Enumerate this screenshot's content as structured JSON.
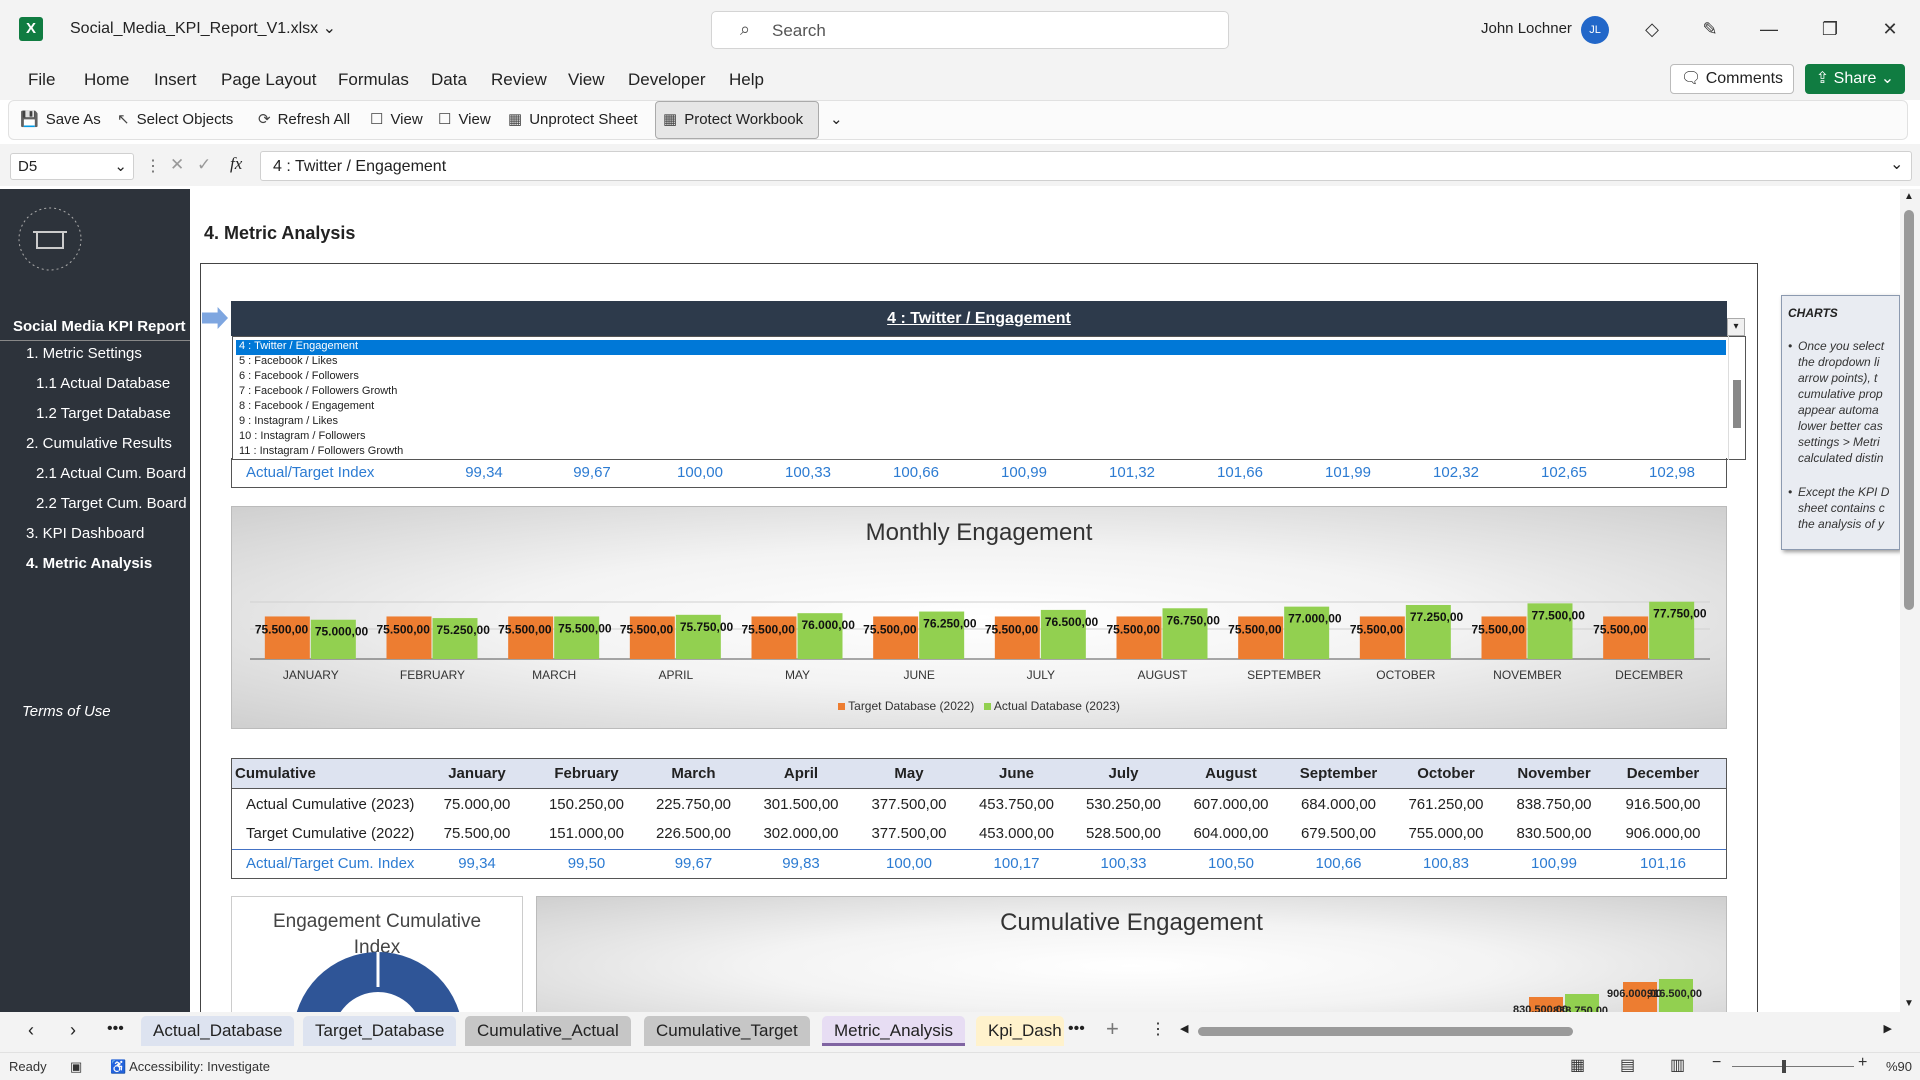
{
  "window": {
    "filename": "Social_Media_KPI_Report_V1.xlsx",
    "search_placeholder": "Search",
    "user": "John Lochner",
    "avatar": "JL"
  },
  "menu": [
    "File",
    "Home",
    "Insert",
    "Page Layout",
    "Formulas",
    "Data",
    "Review",
    "View",
    "Developer",
    "Help"
  ],
  "comments": "Comments",
  "share": "Share",
  "ribbon": {
    "save_as": "Save As",
    "select_objects": "Select Objects",
    "refresh_all": "Refresh All",
    "view1": "View",
    "view2": "View",
    "unprotect": "Unprotect Sheet",
    "protect": "Protect Workbook"
  },
  "formula": {
    "cell": "D5",
    "fx": "fx",
    "value": "4 : Twitter / Engagement"
  },
  "sidebar": {
    "title": "Social Media KPI Report",
    "items": [
      "1. Metric Settings",
      "1.1 Actual Database",
      "1.2 Target Database",
      "2. Cumulative Results",
      "2.1 Actual Cum. Board",
      "2.2 Target Cum. Board",
      "3. KPI Dashboard",
      "4. Metric Analysis"
    ],
    "terms": "Terms of Use"
  },
  "page_title": "4. Metric Analysis",
  "selector": {
    "value": "4 : Twitter / Engagement",
    "options": [
      "4 : Twitter / Engagement",
      "5 : Facebook / Likes",
      "6 : Facebook / Followers",
      "7 : Facebook / Followers Growth",
      "8 : Facebook / Engagement",
      "9 : Instagram / Likes",
      "10 : Instagram / Followers",
      "11 : Instagram / Followers Growth"
    ]
  },
  "index_row": {
    "label": "Actual/Target Index",
    "values": [
      "99,34",
      "99,67",
      "100,00",
      "100,33",
      "100,66",
      "100,99",
      "101,32",
      "101,66",
      "101,99",
      "102,32",
      "102,65",
      "102,98"
    ]
  },
  "chart_data": [
    {
      "type": "bar",
      "title": "Monthly Engagement",
      "categories": [
        "JANUARY",
        "FEBRUARY",
        "MARCH",
        "APRIL",
        "MAY",
        "JUNE",
        "JULY",
        "AUGUST",
        "SEPTEMBER",
        "OCTOBER",
        "NOVEMBER",
        "DECEMBER"
      ],
      "series": [
        {
          "name": "Target Database (2022)",
          "color": "#ed7d31",
          "values": [
            75500,
            75500,
            75500,
            75500,
            75500,
            75500,
            75500,
            75500,
            75500,
            75500,
            75500,
            75500
          ],
          "labels": [
            "75.500,00",
            "75.500,00",
            "75.500,00",
            "75.500,00",
            "75.500,00",
            "75.500,00",
            "75.500,00",
            "75.500,00",
            "75.500,00",
            "75.500,00",
            "75.500,00",
            "75.500,00"
          ]
        },
        {
          "name": "Actual Database (2023)",
          "color": "#92d050",
          "values": [
            75000,
            75250,
            75500,
            75750,
            76000,
            76250,
            76500,
            76750,
            77000,
            77250,
            77500,
            77750
          ],
          "labels": [
            "75.000,00",
            "75.250,00",
            "75.500,00",
            "75.750,00",
            "76.000,00",
            "76.250,00",
            "76.500,00",
            "76.750,00",
            "77.000,00",
            "77.250,00",
            "77.500,00",
            "77.750,00"
          ]
        }
      ],
      "legend": "bottom"
    },
    {
      "type": "bar",
      "title": "Cumulative Engagement",
      "visible_labels": [
        "830.500,00",
        "838.750,00",
        "906.000,00",
        "916.500,00"
      ]
    }
  ],
  "cumulative": {
    "header": [
      "Cumulative",
      "January",
      "February",
      "March",
      "April",
      "May",
      "June",
      "July",
      "August",
      "September",
      "October",
      "November",
      "December"
    ],
    "rows": [
      {
        "label": "Actual Cumulative (2023)",
        "values": [
          "75.000,00",
          "150.250,00",
          "225.750,00",
          "301.500,00",
          "377.500,00",
          "453.750,00",
          "530.250,00",
          "607.000,00",
          "684.000,00",
          "761.250,00",
          "838.750,00",
          "916.500,00"
        ]
      },
      {
        "label": "Target Cumulative (2022)",
        "values": [
          "75.500,00",
          "151.000,00",
          "226.500,00",
          "302.000,00",
          "377.500,00",
          "453.000,00",
          "528.500,00",
          "604.000,00",
          "679.500,00",
          "755.000,00",
          "830.500,00",
          "906.000,00"
        ]
      },
      {
        "label": "Actual/Target Cum. Index",
        "values": [
          "99,34",
          "99,50",
          "99,67",
          "99,83",
          "100,00",
          "100,17",
          "100,33",
          "100,50",
          "100,66",
          "100,83",
          "100,99",
          "101,16"
        ]
      }
    ]
  },
  "gauge_title": "Engagement Cumulative Index",
  "notes": {
    "title": "CHARTS",
    "b1": "Once you select the dropdown li arrow points), t cumulative prop appear automa lower better cas settings > Metri calculated distin",
    "b2": "Except the KPI D sheet contains c the analysis of y"
  },
  "tabs": [
    "Actual_Database",
    "Target_Database",
    "Cumulative_Actual",
    "Cumulative_Target",
    "Metric_Analysis",
    "Kpi_Dash"
  ],
  "status": {
    "ready": "Ready",
    "accessibility": "Accessibility: Investigate",
    "zoom": "%90"
  }
}
